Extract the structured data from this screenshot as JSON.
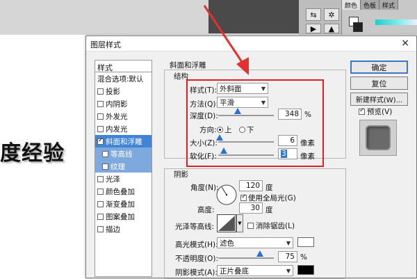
{
  "app": {
    "panel_tabs": [
      "颜色",
      "色板",
      "样式"
    ],
    "watermark_text": "度经验"
  },
  "dialog": {
    "title": "图层样式",
    "left_list": {
      "header": "样式",
      "items": [
        {
          "label": "混合选项:默认",
          "checkbox": false
        },
        {
          "label": "投影",
          "checkbox": true,
          "checked": false
        },
        {
          "label": "内阴影",
          "checkbox": true,
          "checked": false
        },
        {
          "label": "外发光",
          "checkbox": true,
          "checked": false
        },
        {
          "label": "内发光",
          "checkbox": true,
          "checked": false
        },
        {
          "label": "斜面和浮雕",
          "checkbox": true,
          "checked": true,
          "selected": true
        },
        {
          "label": "等高线",
          "checkbox": true,
          "checked": false,
          "sub": true
        },
        {
          "label": "纹理",
          "checkbox": true,
          "checked": false,
          "sub": true
        },
        {
          "label": "光泽",
          "checkbox": true,
          "checked": false
        },
        {
          "label": "颜色叠加",
          "checkbox": true,
          "checked": false
        },
        {
          "label": "渐变叠加",
          "checkbox": true,
          "checked": false
        },
        {
          "label": "图案叠加",
          "checkbox": true,
          "checked": false
        },
        {
          "label": "描边",
          "checkbox": true,
          "checked": false
        }
      ]
    },
    "bevel": {
      "section_title": "斜面和浮雕",
      "structure_title": "结构",
      "style_label": "样式(T):",
      "style_value": "外斜面",
      "technique_label": "方法(Q):",
      "technique_value": "平滑",
      "depth_label": "深度(D):",
      "depth_value": "348",
      "depth_unit": "%",
      "depth_level": 0.35,
      "direction_label": "方向:",
      "direction_up": "上",
      "direction_down": "下",
      "size_label": "大小(Z):",
      "size_value": "6",
      "size_unit": "像素",
      "size_level": 0.03,
      "soften_label": "软化(F):",
      "soften_value": "3",
      "soften_unit": "像素",
      "soften_level": 0.1
    },
    "shading": {
      "title": "阴影",
      "angle_label": "角度(N):",
      "angle_value": "120",
      "angle_unit": "度",
      "global_light_label": "使用全局光(G)",
      "altitude_label": "高度:",
      "altitude_value": "30",
      "altitude_unit": "度",
      "gloss_label": "光泽等高线:",
      "antialias_label": "消除锯齿(L)",
      "highlight_mode_label": "高光模式(H):",
      "highlight_mode_value": "滤色",
      "highlight_color": "#ffffff",
      "opacity_label": "不透明度(O):",
      "opacity_value": "75",
      "opacity_unit": "%",
      "opacity_level": 0.75,
      "shadow_mode_label": "阴影模式(A):",
      "shadow_mode_value": "正片叠底",
      "shadow_color": "#000000"
    },
    "buttons": {
      "ok": "确定",
      "reset": "复位",
      "new_style": "新建样式(W)...",
      "preview": "预览(V)"
    }
  }
}
